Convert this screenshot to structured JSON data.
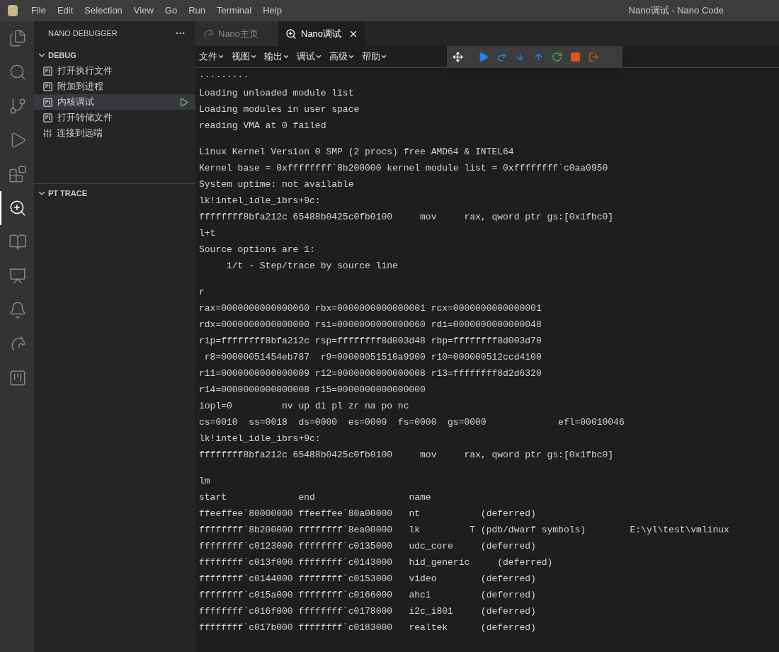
{
  "menu_bar": {
    "items": [
      "File",
      "Edit",
      "Selection",
      "View",
      "Go",
      "Run",
      "Terminal",
      "Help"
    ]
  },
  "window": {
    "title": "Nano调试 - Nano Code"
  },
  "activity_bar": {
    "items": [
      {
        "selected": false
      },
      {
        "selected": false
      },
      {
        "selected": false
      },
      {
        "selected": false
      },
      {
        "selected": false
      },
      {
        "selected": true
      },
      {
        "selected": false
      },
      {
        "selected": false
      },
      {
        "selected": false
      },
      {
        "selected": false
      },
      {
        "selected": false
      }
    ]
  },
  "sidebar": {
    "title": "NANO DEBUGGER",
    "more": "···",
    "sections": [
      {
        "title": "DEBUG",
        "expanded": true,
        "items": [
          {
            "label": "打开执行文件",
            "kind": "local",
            "selected": false
          },
          {
            "label": "附加到进程",
            "kind": "local",
            "selected": false
          },
          {
            "label": "内核调试",
            "kind": "local",
            "selected": true
          },
          {
            "label": "打开转储文件",
            "kind": "local",
            "selected": false
          },
          {
            "label": "连接到远端",
            "kind": "remote",
            "selected": false
          }
        ]
      },
      {
        "title": "PT TRACE",
        "expanded": true
      }
    ]
  },
  "tabs": [
    {
      "label": "Nano主页",
      "selected": false
    },
    {
      "label": "Nano调试",
      "selected": true
    }
  ],
  "tool_menu": {
    "items": [
      "文件",
      "视图",
      "输出",
      "调试",
      "高级",
      "帮助"
    ]
  },
  "console": {
    "blocks": [
      [
        "·········",
        "Loading unloaded module list",
        "Loading modules in user space",
        "reading VMA at 0 failed"
      ],
      [
        "Linux Kernel Version 0 SMP (2 procs) free AMD64 & INTEL64",
        "Kernel base = 0xffffffff`8b200000 kernel module list = 0xffffffff`c0aa0950",
        "System uptime: not available",
        "lk!intel_idle_ibrs+9c:",
        "ffffffff8bfa212c 65488b0425c0fb0100     mov     rax, qword ptr gs:[0x1fbc0]",
        "l+t",
        "Source options are 1:",
        "     1/t - Step/trace by source line"
      ],
      [
        "r",
        "rax=0000000000000060 rbx=0000000000000001 rcx=0000000000000001",
        "rdx=0000000000000000 rsi=0000000000000060 rdi=0000000000000048",
        "rip=ffffffff8bfa212c rsp=ffffffff8d003d48 rbp=ffffffff8d003d70",
        " r8=00000051454eb787  r9=00000051510a9900 r10=000000512ccd4100",
        "r11=0000000000000009 r12=0000000000000008 r13=ffffffff8d2d6320",
        "r14=0000000000000008 r15=0000000000000000",
        "iopl=0         nv up di pl zr na po nc",
        "cs=0010  ss=0018  ds=0000  es=0000  fs=0000  gs=0000             efl=00010046",
        "lk!intel_idle_ibrs+9c:",
        "ffffffff8bfa212c 65488b0425c0fb0100     mov     rax, qword ptr gs:[0x1fbc0]"
      ],
      [
        "lm",
        "start             end                 name",
        "ffeeffee`80000000 ffeeffee`80a00000   nt           (deferred)",
        "ffffffff`8b200000 ffffffff`8ea00000   lk         T (pdb/dwarf symbols)        E:\\yl\\test\\vmlinux",
        "ffffffff`c0123000 ffffffff`c0135000   udc_core     (deferred)",
        "ffffffff`c013f000 ffffffff`c0143000   hid_generic     (deferred)",
        "ffffffff`c0144000 ffffffff`c0153000   video        (deferred)",
        "ffffffff`c015a000 ffffffff`c0166000   ahci         (deferred)",
        "ffffffff`c016f000 ffffffff`c0178000   i2c_i801     (deferred)",
        "ffffffff`c017b000 ffffffff`c0183000   realtek      (deferred)"
      ]
    ]
  }
}
